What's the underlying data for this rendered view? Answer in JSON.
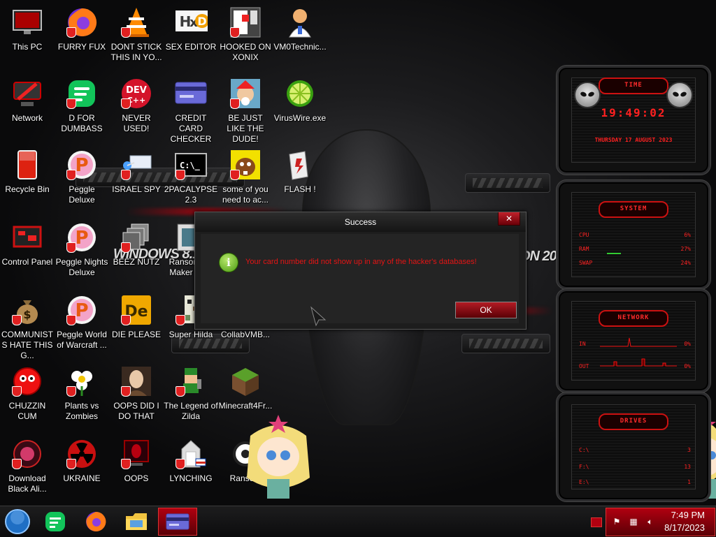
{
  "desktop_icons": [
    {
      "label": "This PC",
      "icon": "monitor-icon"
    },
    {
      "label": "FURRY FUX",
      "icon": "firefox-icon"
    },
    {
      "label": "DONT STICK THIS IN YO...",
      "icon": "vlc-cone-icon"
    },
    {
      "label": "SEX EDITOR",
      "icon": "hxd-editor-icon"
    },
    {
      "label": "HOOKED ON XONIX",
      "icon": "xonix-game-icon"
    },
    {
      "label": "VM0Technic...",
      "icon": "doctor-person-icon"
    },
    {
      "label": "Network",
      "icon": "network-icon"
    },
    {
      "label": "D FOR DUMBASS",
      "icon": "green-document-icon"
    },
    {
      "label": "NEVER USED!",
      "icon": "dev-cpp-icon"
    },
    {
      "label": "CREDIT CARD CHECKER",
      "icon": "credit-card-icon"
    },
    {
      "label": "BE JUST LIKE THE DUDE!",
      "icon": "santa-elf-icon"
    },
    {
      "label": "VirusWire.exe",
      "icon": "lime-icon"
    },
    {
      "label": "Recycle Bin",
      "icon": "recycle-bin-icon"
    },
    {
      "label": "Peggle Deluxe",
      "icon": "peggle-icon"
    },
    {
      "label": "ISRAEL SPY",
      "icon": "spy-tool-icon"
    },
    {
      "label": "2PACALYPSE 2.3",
      "icon": "terminal-icon"
    },
    {
      "label": "some of you need to ac...",
      "icon": "beaver-icon"
    },
    {
      "label": "FLASH !",
      "icon": "flash-file-icon"
    },
    {
      "label": "Control Panel",
      "icon": "control-panel-icon"
    },
    {
      "label": "Peggle Nights Deluxe",
      "icon": "peggle-icon"
    },
    {
      "label": "BEEZ NUTZ",
      "icon": "stacked-windows-icon"
    },
    {
      "label": "Ransomw... Maker Bu...",
      "icon": "window-frame-icon"
    },
    {
      "label": "COMMUNISTS HATE THIS G...",
      "icon": "money-bag-icon"
    },
    {
      "label": "Peggle World of Warcraft ...",
      "icon": "peggle-icon"
    },
    {
      "label": "DIE PLEASE",
      "icon": "de-app-icon"
    },
    {
      "label": "Super Hilda",
      "icon": "pixel-character-icon"
    },
    {
      "label": "CollabVMB...",
      "icon": "collabvm-icon"
    },
    {
      "label": "CHUZZIN CUM",
      "icon": "chuzzle-icon"
    },
    {
      "label": "Plants vs Zombies",
      "icon": "flower-icon"
    },
    {
      "label": "OOPS DID I DO THAT",
      "icon": "portrait-icon"
    },
    {
      "label": "The Legend of Zilda",
      "icon": "zelda-sprite-icon"
    },
    {
      "label": "Minecraft4Fr...",
      "icon": "grass-block-icon"
    },
    {
      "label": "Download Black Ali...",
      "icon": "black-alien-icon"
    },
    {
      "label": "UKRAINE",
      "icon": "radiation-icon"
    },
    {
      "label": "OOPS",
      "icon": "red-monitor-icon"
    },
    {
      "label": "LYNCHING",
      "icon": "tower-icon"
    },
    {
      "label": "Ranso...",
      "icon": "ransom-icon"
    }
  ],
  "wallpaper": {
    "text_left": "WiNDOWS 8.1",
    "text_right": "ON 20"
  },
  "dialog": {
    "title": "Success",
    "close_label": "✕",
    "message": "Your card number did not show up in any of the hacker's databases!",
    "ok_label": "OK",
    "info_icon": "i"
  },
  "gadgets": {
    "time": {
      "header": "TIME",
      "clock": "19:49:02",
      "date": "THURSDAY 17 AUGUST 2023"
    },
    "system": {
      "header": "SYSTEM",
      "rows": [
        {
          "label": "CPU",
          "value": "6%"
        },
        {
          "label": "RAM",
          "value": "27%"
        },
        {
          "label": "SWAP",
          "value": "24%"
        }
      ]
    },
    "network": {
      "header": "NETWORK",
      "rows": [
        {
          "label": "IN",
          "value": "0%"
        },
        {
          "label": "OUT",
          "value": "0%"
        }
      ]
    },
    "drives": {
      "header": "DRIVES",
      "rows": [
        {
          "label": "C:\\",
          "value": "3"
        },
        {
          "label": "F:\\",
          "value": "13"
        },
        {
          "label": "E:\\",
          "value": "1"
        }
      ]
    }
  },
  "taskbar": {
    "items": [
      {
        "name": "start-orb",
        "icon": "start-orb-icon"
      },
      {
        "name": "app-green",
        "icon": "green-document-icon"
      },
      {
        "name": "firefox",
        "icon": "firefox-icon"
      },
      {
        "name": "explorer",
        "icon": "folder-icon"
      },
      {
        "name": "credit-card-checker",
        "icon": "credit-card-icon",
        "active": true
      }
    ],
    "clock_time": "7:49 PM",
    "clock_date": "8/17/2023"
  },
  "colors": {
    "accent_red": "#e61414",
    "tray_red": "#b00010",
    "gadget_red": "#ff2020"
  }
}
